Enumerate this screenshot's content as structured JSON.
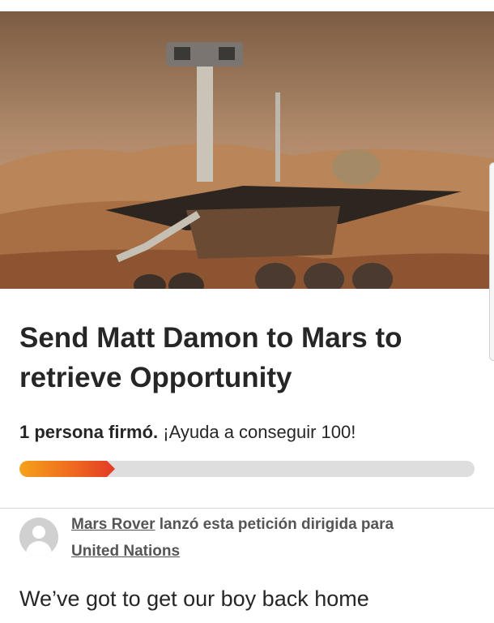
{
  "hero_image": {
    "alt_icon": "mars-rover-photo",
    "colors": {
      "sky": "#8a6a4f",
      "ground": "#b8855e"
    }
  },
  "petition": {
    "title_line1": "Send Matt Damon to Mars to",
    "title_line2": "retrieve Opportunity",
    "signed_count_text": "1 persona firmó.",
    "goal_text": "¡Ayuda a conseguir 100!",
    "progress_fraction": 0.21,
    "progress_colors": {
      "start": "#f4a21a",
      "end": "#e23b26",
      "track": "#dedede"
    }
  },
  "starter": {
    "author": "Mars Rover",
    "action_text": "lanzó esta petición dirigida para",
    "target": "United Nations",
    "avatar_icon": "user-avatar-icon"
  },
  "description": "We’ve got to get our boy back home"
}
